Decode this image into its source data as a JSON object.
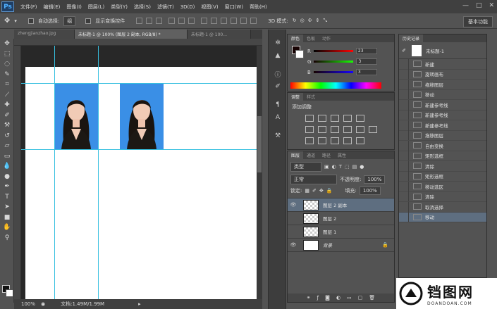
{
  "app": {
    "logo": "Ps"
  },
  "menubar": {
    "items": [
      "文件(F)",
      "编辑(E)",
      "图像(I)",
      "图层(L)",
      "类型(Y)",
      "选择(S)",
      "滤镜(T)",
      "3D(D)",
      "视图(V)",
      "窗口(W)",
      "帮助(H)"
    ],
    "window_controls": [
      "—",
      "□",
      "✕"
    ]
  },
  "options": {
    "auto_select_label": "自动选择:",
    "auto_select_value": "组",
    "show_transform_label": "显示变换控件",
    "mode_3d_label": "3D 模式:",
    "workspace": "基本功能"
  },
  "tabs": [
    {
      "label": "zhengjianzhao.jpg",
      "active": false
    },
    {
      "label": "未标题-1 @ 100% (图层 2 副本, RGB/8) *",
      "active": true
    },
    {
      "label": "未标题-1 @ 100...",
      "active": false
    }
  ],
  "status": {
    "zoom": "100%",
    "doc": "文档:1.49M/1.99M"
  },
  "color_panel": {
    "tabs": [
      "颜色",
      "色板",
      "动作"
    ],
    "channels": [
      {
        "label": "R",
        "value": "23"
      },
      {
        "label": "G",
        "value": "3"
      },
      {
        "label": "B",
        "value": "3"
      }
    ]
  },
  "adjust_panel": {
    "tabs": [
      "调整",
      "样式"
    ],
    "title": "添加调整"
  },
  "layers_panel": {
    "tabs": [
      "图层",
      "通道",
      "路径",
      "属性"
    ],
    "kind_label": "类型",
    "blend_mode": "正常",
    "opacity_label": "不透明度:",
    "opacity_value": "100%",
    "lock_label": "锁定:",
    "fill_label": "填充:",
    "fill_value": "100%",
    "layers": [
      {
        "name": "图层 2 副本",
        "selected": true,
        "visible": true,
        "white": false
      },
      {
        "name": "图层 2",
        "selected": false,
        "visible": false,
        "white": false
      },
      {
        "name": "图层 1",
        "selected": false,
        "visible": false,
        "white": false
      },
      {
        "name": "背景",
        "selected": false,
        "visible": true,
        "white": true
      }
    ]
  },
  "history_panel": {
    "title": "历史记录",
    "snapshot": "未标题-1",
    "items": [
      "新建",
      "旋转画布",
      "拖移图层",
      "移动",
      "新建参考线",
      "新建参考线",
      "新建参考线",
      "拖移图层",
      "自由变换",
      "矩形选框",
      "清除",
      "矩形选框",
      "移动选区",
      "清除",
      "取消选择",
      "移动"
    ]
  },
  "watermark": {
    "text": "铛图网",
    "url": "DOANDOAN.COM"
  },
  "colors": {
    "accent_selected": "#5e6e80",
    "guide": "#37c0e0",
    "photo_bg": "#3a8fe6"
  }
}
